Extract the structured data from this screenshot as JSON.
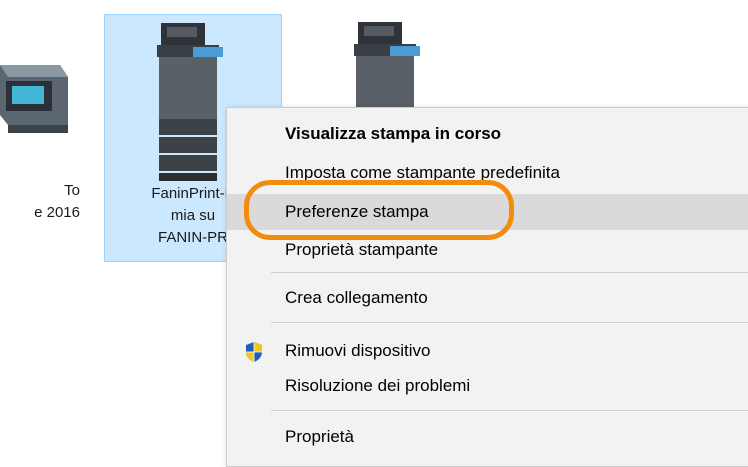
{
  "desktop": {
    "items": [
      {
        "label_line1": "To",
        "label_line2": "e 2016"
      },
      {
        "label_line1": "FaninPrint-E",
        "label_line2": "mia su",
        "label_line3": "FANIN-PR"
      },
      {
        "label_line1": ""
      }
    ]
  },
  "context_menu": {
    "items": [
      {
        "label": "Visualizza stampa in corso"
      },
      {
        "label": "Imposta come stampante predefinita"
      },
      {
        "label": "Preferenze stampa"
      },
      {
        "label": "Proprietà stampante"
      },
      {
        "label": "Crea collegamento"
      },
      {
        "label": "Rimuovi dispositivo",
        "icon": "shield-icon"
      },
      {
        "label": "Risoluzione dei problemi"
      },
      {
        "label": "Proprietà"
      }
    ]
  },
  "colors": {
    "highlight_ring": "#f28c0f",
    "selection_bg": "#cce8ff",
    "menu_bg": "#f2f2f2",
    "menu_hover": "#dadada"
  }
}
